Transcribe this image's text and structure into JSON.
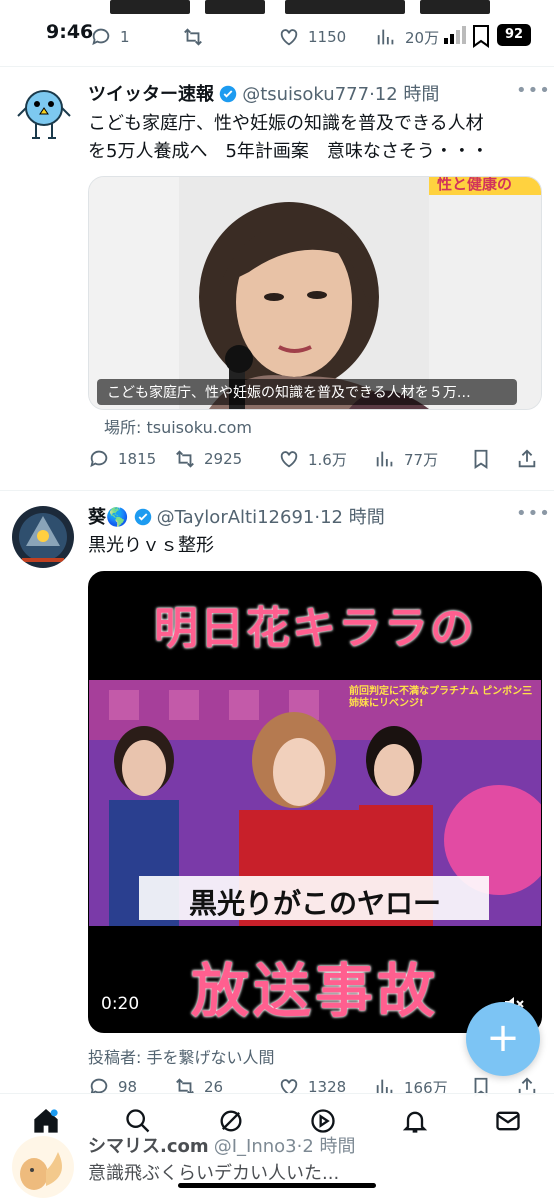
{
  "status": {
    "time": "9:46",
    "battery": "92"
  },
  "prev_tweet_metrics": {
    "replies": "1",
    "retweets": "",
    "likes": "1150",
    "views": "20万"
  },
  "tweet1": {
    "name": "ツイッター速報",
    "handle": "@tsuisoku777",
    "time": "·12 時間",
    "text_line1": "こども家庭庁、性や妊娠の知識を普及できる人材",
    "text_line2": "を5万人養成へ　5年計画案　意味なさそう・・・",
    "media_caption": "こども家庭庁、性や妊娠の知識を普及できる人材を５万…",
    "media_corner_text": "性と健康の",
    "source": "場所: tsuisoku.com",
    "replies": "1815",
    "retweets": "2925",
    "likes": "1.6万",
    "views": "77万"
  },
  "tweet2": {
    "name": "葵🌎",
    "handle": "@TaylorAlti12691",
    "time": "·12 時間",
    "text": "黒光りｖｓ整形",
    "video_title": "明日花キララの",
    "video_subtitle": "黒光りがこのヤロー",
    "video_banner": "前回判定に不満なプラチナム ピンボン三姉妹にリベンジ!",
    "video_bottom": "放送事故",
    "duration": "0:20",
    "poster": "投稿者: 手を繋げない人間",
    "replies": "98",
    "retweets": "26",
    "likes": "1328",
    "views": "166万"
  },
  "tweet3": {
    "name": "シマリス.com",
    "handle": "@I_Inno3",
    "time": "·2 時間",
    "text": "意識飛ぶくらいデカい人いた..."
  },
  "fab": {
    "label": "+"
  },
  "colors": {
    "accent": "#1d9bf0",
    "fab": "#7cc4f4",
    "muted": "#536471"
  }
}
